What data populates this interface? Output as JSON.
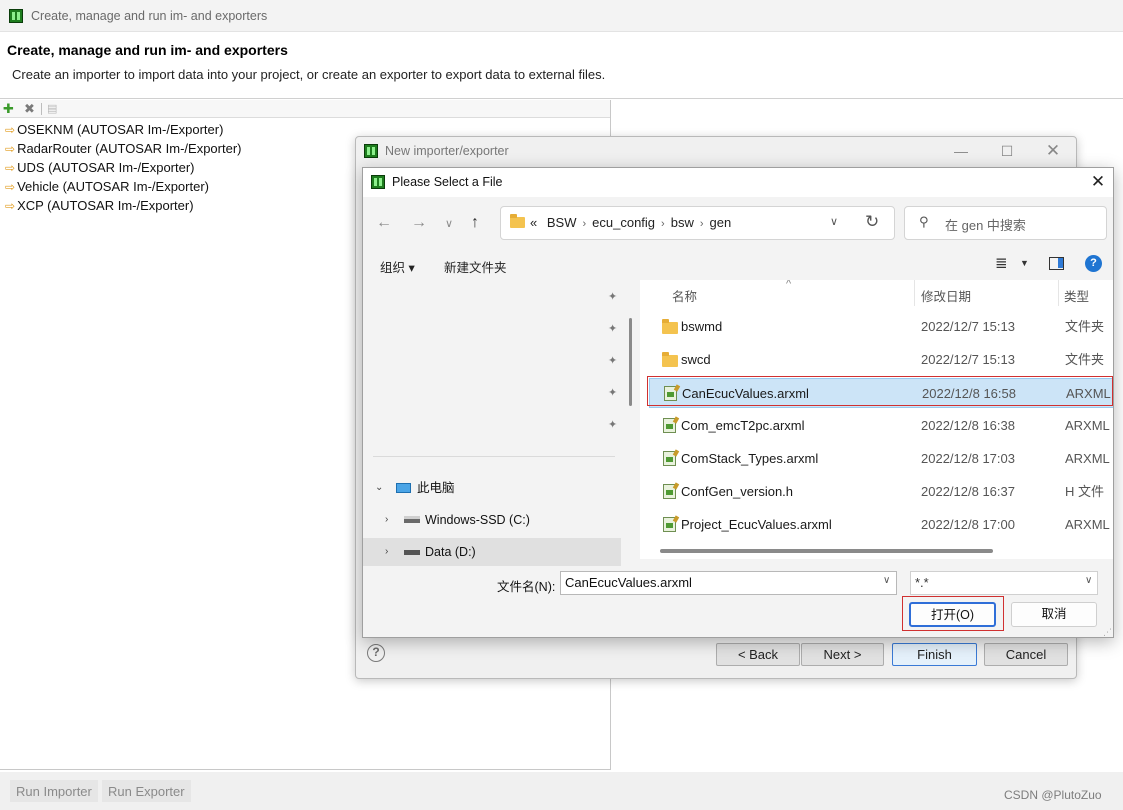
{
  "main_window": {
    "title": "Create, manage and run im- and exporters",
    "heading": "Create, manage and run im- and exporters",
    "description": "Create an importer to import data into your project, or create an exporter to export data to external files.",
    "toolbar": {
      "add_icon": "plus-icon",
      "delete_icon": "delete-icon",
      "copy_icon": "copy-icon"
    },
    "items": [
      "OSEKNM (AUTOSAR Im-/Exporter)",
      "RadarRouter (AUTOSAR Im-/Exporter)",
      "UDS (AUTOSAR Im-/Exporter)",
      "Vehicle (AUTOSAR Im-/Exporter)",
      "XCP (AUTOSAR Im-/Exporter)"
    ],
    "run_importer": "Run Importer",
    "run_exporter": "Run Exporter"
  },
  "wizard": {
    "title": "New importer/exporter",
    "back": "< Back",
    "next": "Next >",
    "finish": "Finish",
    "cancel": "Cancel"
  },
  "file_dialog": {
    "title": "Please Select a File",
    "breadcrumb": [
      "BSW",
      "ecu_config",
      "bsw",
      "gen"
    ],
    "breadcrumb_prefix": "«",
    "search_placeholder": "在 gen 中搜索",
    "organize": "组织 ▾",
    "new_folder": "新建文件夹",
    "columns": {
      "name": "名称",
      "date": "修改日期",
      "type": "类型"
    },
    "files": [
      {
        "name": "bswmd",
        "date": "2022/12/7 15:13",
        "type": "文件夹",
        "kind": "folder"
      },
      {
        "name": "swcd",
        "date": "2022/12/7 15:13",
        "type": "文件夹",
        "kind": "folder"
      },
      {
        "name": "CanEcucValues.arxml",
        "date": "2022/12/8 16:58",
        "type": "ARXML",
        "kind": "file",
        "selected": true
      },
      {
        "name": "Com_emcT2pc.arxml",
        "date": "2022/12/8 16:38",
        "type": "ARXML 文",
        "kind": "file"
      },
      {
        "name": "ComStack_Types.arxml",
        "date": "2022/12/8 17:03",
        "type": "ARXML 文",
        "kind": "file"
      },
      {
        "name": "ConfGen_version.h",
        "date": "2022/12/8 16:37",
        "type": "H 文件",
        "kind": "file"
      },
      {
        "name": "Project_EcucValues.arxml",
        "date": "2022/12/8 17:00",
        "type": "ARXML 文",
        "kind": "file"
      }
    ],
    "tree": {
      "this_pc": "此电脑",
      "drive_c": "Windows-SSD (C:)",
      "drive_d": "Data (D:)"
    },
    "filename_label": "文件名(N):",
    "filename_value": "CanEcucValues.arxml",
    "filter_value": "*.*",
    "open": "打开(O)",
    "cancel": "取消"
  },
  "watermark": "CSDN @PlutoZuo",
  "colors": {
    "highlight_red": "#d03030",
    "selection_blue": "#cce4f7",
    "accent_blue": "#2f6ed8"
  }
}
